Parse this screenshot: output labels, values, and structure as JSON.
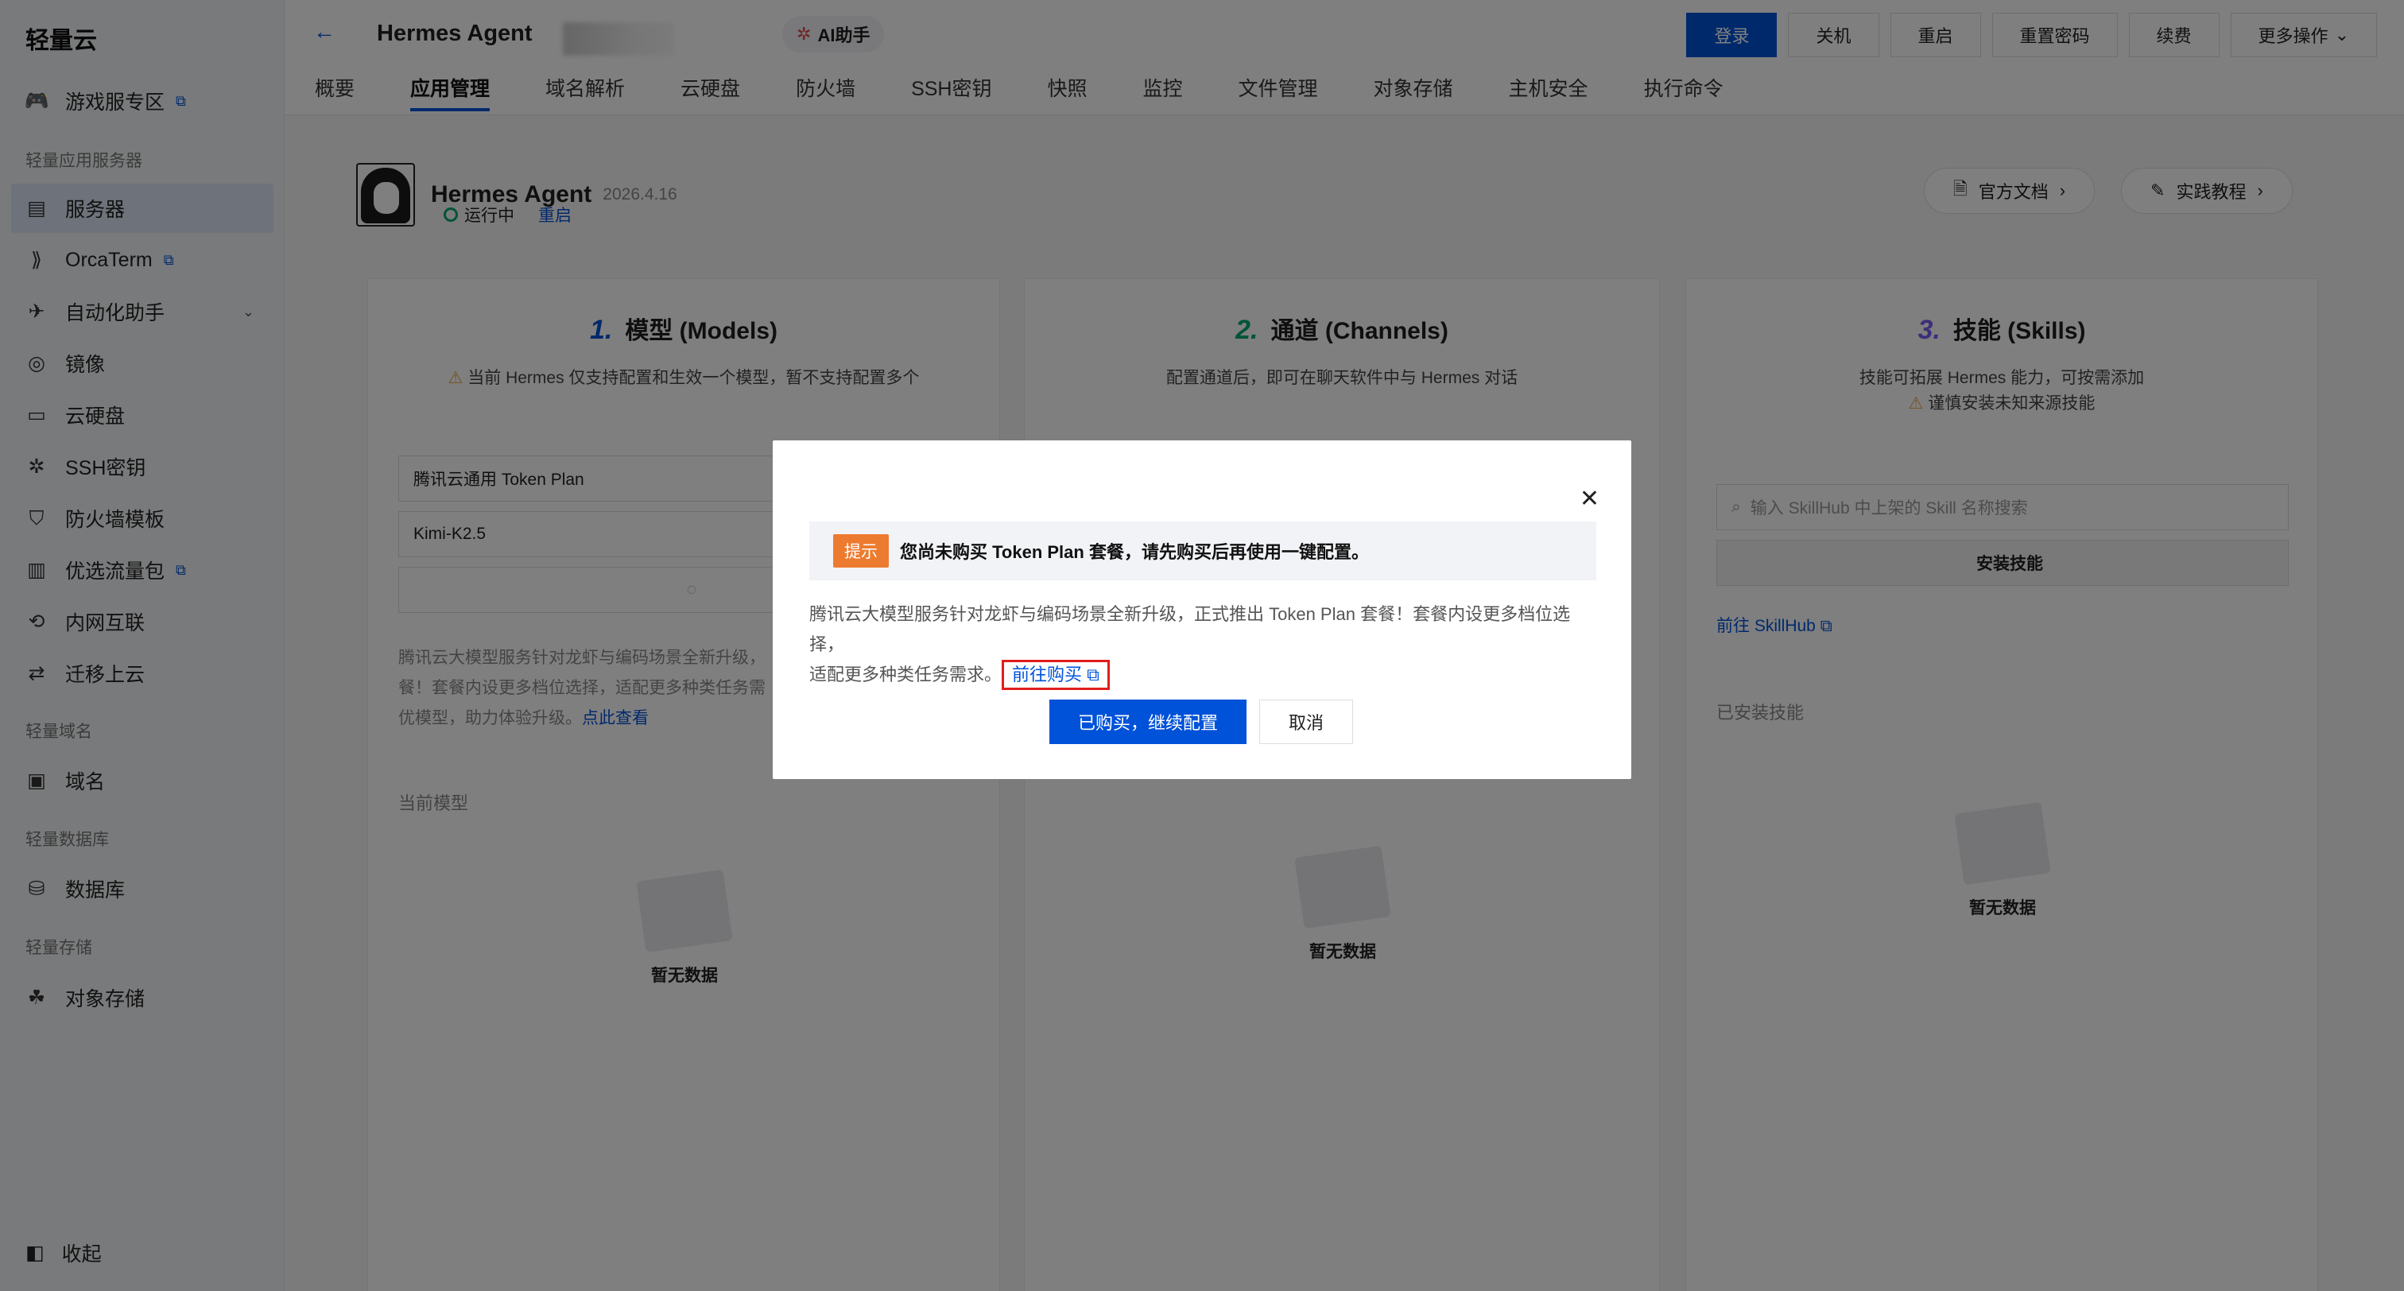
{
  "app": {
    "logo": "轻量云"
  },
  "sidebar": {
    "items": [
      {
        "label": "游戏服专区",
        "ext": true
      },
      {
        "label": "服务器",
        "active": true
      },
      {
        "label": "OrcaTerm",
        "ext": true
      },
      {
        "label": "自动化助手",
        "chevron": true
      },
      {
        "label": "镜像"
      },
      {
        "label": "云硬盘"
      },
      {
        "label": "SSH密钥"
      },
      {
        "label": "防火墙模板"
      },
      {
        "label": "优选流量包",
        "ext": true
      },
      {
        "label": "内网互联"
      },
      {
        "label": "迁移上云"
      },
      {
        "label": "域名"
      },
      {
        "label": "数据库"
      },
      {
        "label": "对象存储"
      }
    ],
    "groups": {
      "light_server": "轻量应用服务器",
      "light_domain": "轻量域名",
      "light_db": "轻量数据库",
      "light_storage": "轻量存储"
    },
    "collapse": "收起"
  },
  "header": {
    "title": "Hermes Agent",
    "ai_assistant": "AI助手",
    "actions": {
      "login": "登录",
      "shutdown": "关机",
      "restart": "重启",
      "reset_password": "重置密码",
      "renew": "续费",
      "more": "更多操作"
    }
  },
  "tabs": [
    "概要",
    "应用管理",
    "域名解析",
    "云硬盘",
    "防火墙",
    "SSH密钥",
    "快照",
    "监控",
    "文件管理",
    "对象存储",
    "主机安全",
    "执行命令"
  ],
  "agent": {
    "name": "Hermes Agent",
    "version": "2026.4.16",
    "status": "运行中",
    "restart": "重启",
    "docs": "官方文档",
    "tutorial": "实践教程"
  },
  "panels": {
    "models": {
      "num": "1.",
      "title": "模型 (Models)",
      "notice": "当前 Hermes 仅支持配置和生效一个模型，暂不支持配置多个",
      "provider": "腾讯云通用 Token Plan",
      "model": "Kimi-K2.5",
      "desc": "腾讯云大模型服务针对龙虾与编码场景全新升级，",
      "desc2": "餐！套餐内设更多档位选择，适配更多种类任务需",
      "desc3": "优模型，助力体验升级。",
      "desc_link": "点此查看",
      "current": "当前模型",
      "empty": "暂无数据"
    },
    "channels": {
      "num": "2.",
      "title": "通道 (Channels)",
      "notice": "配置通道后，即可在聊天软件中与 Hermes 对话",
      "empty": "暂无数据"
    },
    "skills": {
      "num": "3.",
      "title": "技能 (Skills)",
      "notice": "技能可拓展 Hermes 能力，可按需添加",
      "warning": "谨慎安装未知来源技能",
      "search_placeholder": "输入 SkillHub 中上架的 Skill 名称搜索",
      "install": "安装技能",
      "goto": "前往 SkillHub",
      "installed": "已安装技能",
      "empty": "暂无数据"
    }
  },
  "modal": {
    "tag": "提示",
    "tip": "您尚未购买 Token Plan 套餐，请先购买后再使用一键配置。",
    "desc": "腾讯云大模型服务针对龙虾与编码场景全新升级，正式推出 Token Plan 套餐！套餐内设更多档位选择，",
    "desc2": "适配更多种类任务需求。",
    "link": "前往购买",
    "confirm": "已购买，继续配置",
    "cancel": "取消"
  }
}
